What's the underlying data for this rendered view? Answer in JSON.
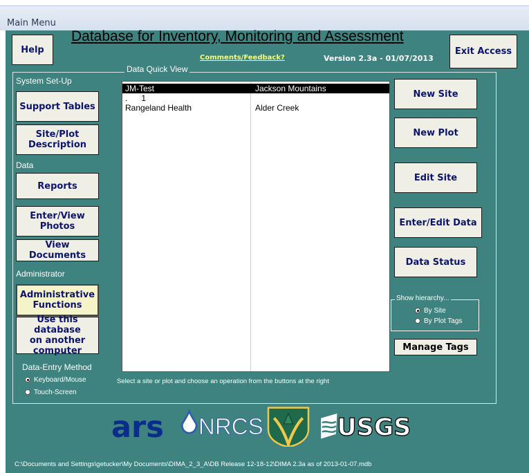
{
  "window": {
    "title": "Main Menu"
  },
  "header": {
    "help": "Help",
    "title": "Database for Inventory, Monitoring and Assessment",
    "feedback": "Comments/Feedback?",
    "version": "Version 2.3a - 01/07/2013",
    "exit": "Exit Access"
  },
  "left": {
    "system_setup": "System Set-Up",
    "support_tables": "Support Tables",
    "site_plot": "Site/Plot\nDescription",
    "data": "Data",
    "reports": "Reports",
    "enter_photos": "Enter/View\nPhotos",
    "view_documents": "View Documents",
    "administrator": "Administrator",
    "admin_functions": "Administrative\nFunctions",
    "use_db": "Use this database\non another\ncomputer",
    "entry_method": "Data-Entry Method",
    "keyboard": "Keyboard/Mouse",
    "touch": "Touch-Screen"
  },
  "quickview": {
    "legend": "Data Quick View",
    "rows": [
      {
        "c1": "JM-Test",
        "c2": "Jackson Mountains"
      },
      {
        "c1": ".      1",
        "c2": ""
      },
      {
        "c1": "Rangeland Health",
        "c2": "Alder Creek"
      }
    ],
    "hint": "Select a site or plot and choose an operation from the buttons at the right"
  },
  "right": {
    "new_site": "New Site",
    "new_plot": "New Plot",
    "edit_site": "Edit Site",
    "enter_edit": "Enter/Edit Data",
    "data_status": "Data Status",
    "hierarchy": "Show hierarchy...",
    "by_site": "By Site",
    "by_plot_tags": "By Plot Tags",
    "manage_tags": "Manage Tags"
  },
  "logos": {
    "ars": "ars",
    "nrcs": "NRCS",
    "usgs": "USGS"
  },
  "footer": {
    "path": "C:\\Documents and Settings\\getucker\\My Documents\\DIMA_2_3_A\\DB Release 12-18-12\\DIMA 2.3a as of 2013-01-07.mdb"
  }
}
